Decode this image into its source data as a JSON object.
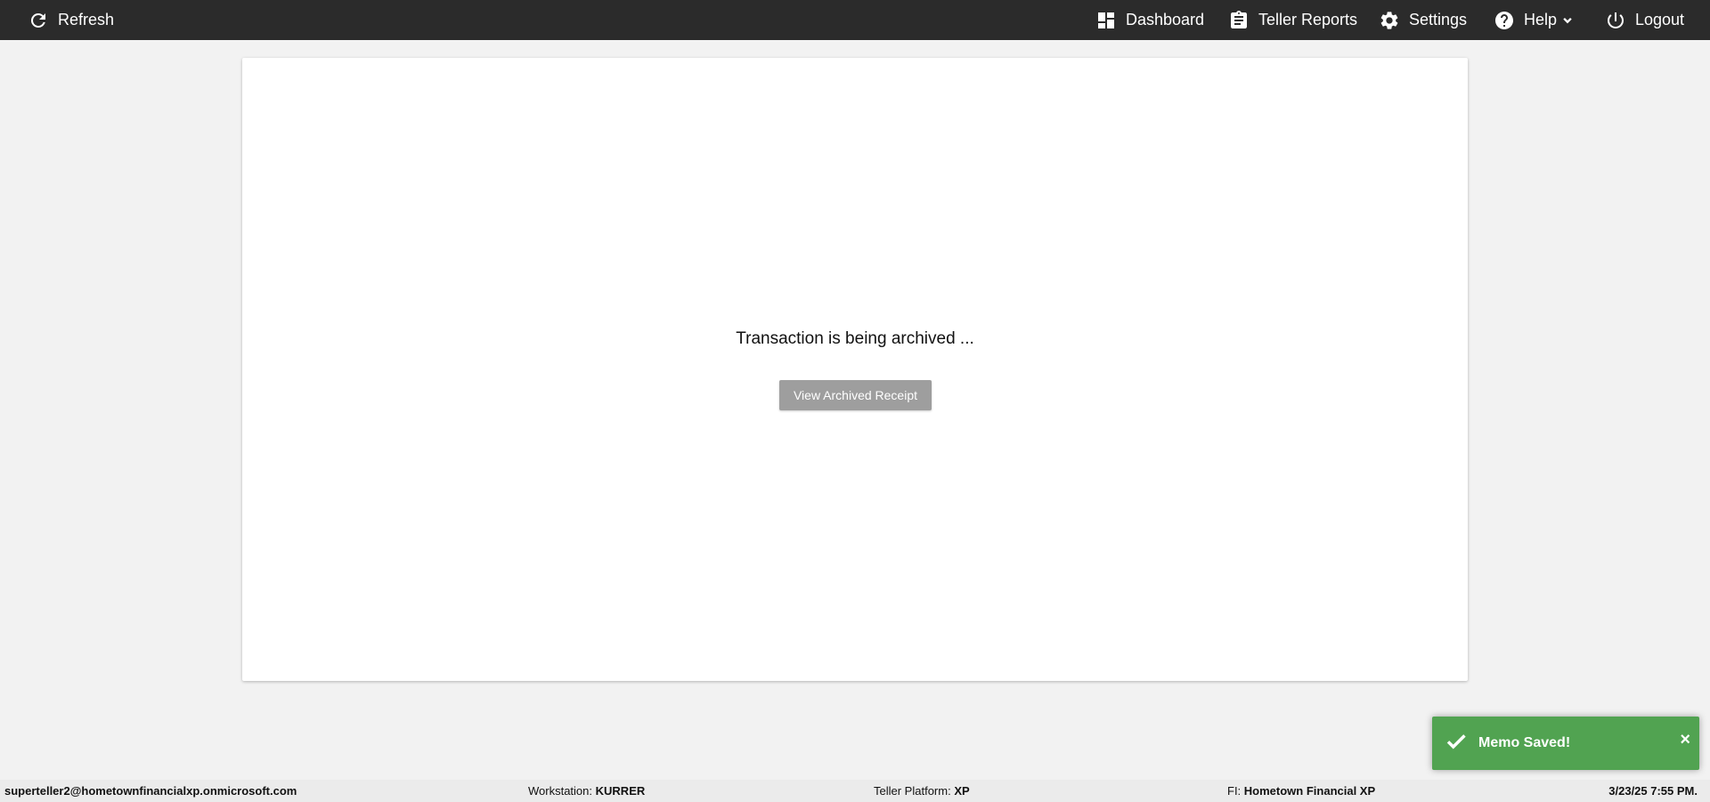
{
  "topbar": {
    "refresh_label": "Refresh",
    "nav": {
      "dashboard": "Dashboard",
      "teller_reports": "Teller Reports",
      "settings": "Settings",
      "help": "Help",
      "logout": "Logout"
    }
  },
  "main": {
    "status_message": "Transaction is being archived ...",
    "view_receipt_button": "View Archived Receipt"
  },
  "toast": {
    "message": "Memo Saved!",
    "close_symbol": "×",
    "color": "#51a351"
  },
  "footer": {
    "user": "superteller2@hometownfinancialxp.onmicrosoft.com",
    "workstation_label": "Workstation:",
    "workstation_value": "KURRER",
    "platform_label": "Teller Platform:",
    "platform_value": "XP",
    "fi_label": "FI:",
    "fi_value": "Hometown Financial XP",
    "datetime": "3/23/25 7:55 PM."
  },
  "colors": {
    "topbar_bg": "#2b2b2b",
    "page_bg": "#f2f2f2",
    "button_disabled": "#9e9e9e"
  },
  "icons": {
    "refresh": "refresh-icon",
    "dashboard": "dashboard-icon",
    "reports": "clipboard-icon",
    "settings": "gear-icon",
    "help": "question-circle-icon",
    "logout": "power-icon",
    "toast": "check-icon"
  }
}
